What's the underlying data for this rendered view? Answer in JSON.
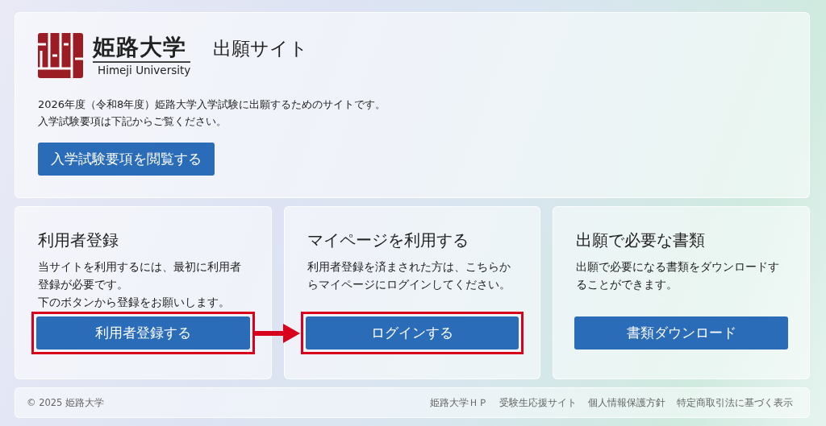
{
  "header": {
    "logo_name": "姫路大学",
    "logo_name_en": "Himeji University",
    "site_title": "出願サイト",
    "description": [
      "2026年度（令和8年度）姫路大学入学試験に出願するためのサイトです。",
      "入学試験要項は下記からご覧ください。"
    ],
    "button": "入学試験要項を閲覧する"
  },
  "cards": [
    {
      "title": "利用者登録",
      "description": [
        "当サイトを利用するには、最初に利用者登録が必要です。",
        "下のボタンから登録をお願いします。"
      ],
      "button": "利用者登録する",
      "highlighted": true,
      "arrow_to_next": true
    },
    {
      "title": "マイページを利用する",
      "description": [
        "利用者登録を済まされた方は、こちらからマイページにログインしてください。"
      ],
      "button": "ログインする",
      "highlighted": true,
      "arrow_to_next": false
    },
    {
      "title": "出願で必要な書類",
      "description": [
        "出願で必要になる書類をダウンロードすることができます。"
      ],
      "button": "書類ダウンロード",
      "highlighted": false,
      "arrow_to_next": false
    }
  ],
  "footer": {
    "copyright": "© 2025 姫路大学",
    "links": [
      "姫路大学ＨＰ",
      "受験生応援サイト",
      "個人情報保護方針",
      "特定商取引法に基づく表示"
    ]
  }
}
